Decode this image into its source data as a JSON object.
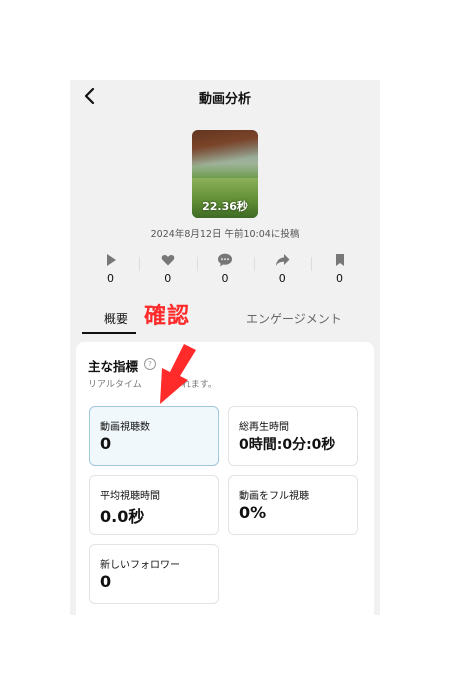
{
  "header": {
    "title": "動画分析",
    "back_icon": "chevron-left-icon"
  },
  "video": {
    "duration": "22.36秒",
    "posted": "2024年8月12日 午前10:04に投稿"
  },
  "stats": [
    {
      "icon": "play-icon",
      "value": "0"
    },
    {
      "icon": "heart-icon",
      "value": "0"
    },
    {
      "icon": "comment-icon",
      "value": "0"
    },
    {
      "icon": "share-icon",
      "value": "0"
    },
    {
      "icon": "bookmark-icon",
      "value": "0"
    }
  ],
  "tabs": {
    "overview": "概要",
    "engagement": "エンゲージメント"
  },
  "annotation": {
    "label": "確認",
    "color": "#ff2a2a"
  },
  "main": {
    "title": "主な指標",
    "subtitle": "リアルタイム",
    "subtitle_tail": "れます。",
    "metrics": [
      {
        "label": "動画視聴数",
        "value": "0"
      },
      {
        "label": "総再生時間",
        "value": "0時間:0分:0秒"
      },
      {
        "label": "平均視聴時間",
        "value": "0.0秒"
      },
      {
        "label": "動画をフル視聴",
        "value": "0%"
      },
      {
        "label": "新しいフォロワー",
        "value": "0"
      }
    ]
  }
}
